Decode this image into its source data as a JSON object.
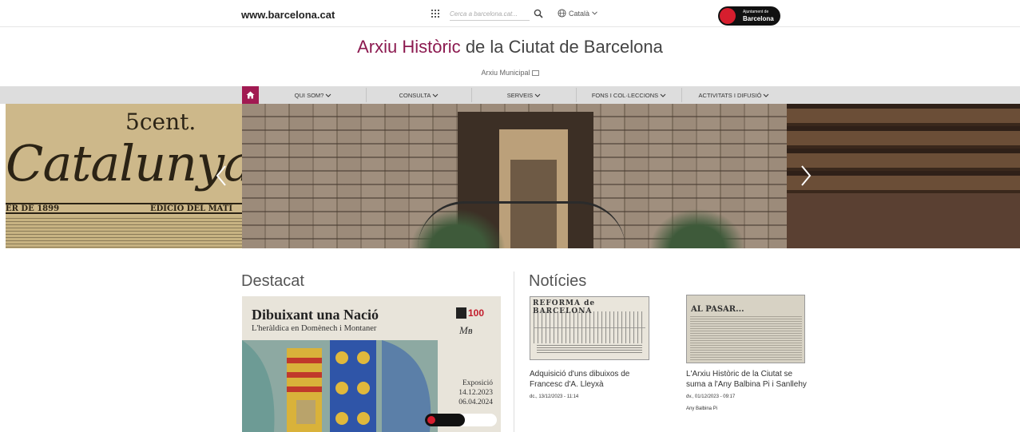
{
  "header": {
    "site_link": "www.barcelona.cat",
    "search_placeholder": "Cerca a barcelona.cat...",
    "language": "Català",
    "logo_line1": "Ajuntament de",
    "logo_line2": "Barcelona"
  },
  "page_title": {
    "accent": "Arxiu Històric",
    "rest": "de la Ciutat de Barcelona",
    "subtitle": "Arxiu Municipal"
  },
  "nav": {
    "items": [
      {
        "label": "Qui som?"
      },
      {
        "label": "Consulta"
      },
      {
        "label": "Serveis"
      },
      {
        "label": "Fons i col·leccions"
      },
      {
        "label": "Activitats i difusió"
      }
    ]
  },
  "carousel": {
    "left_slide": {
      "price": "5cent.",
      "masthead": "Catalunya",
      "date_text": "ER DE 1899",
      "edition_text": "EDICIÓ DEL MATÍ"
    }
  },
  "destacat": {
    "title": "Destacat",
    "poster": {
      "title": "Dibuixant una Nació",
      "subtitle": "L'heràldica en Domènech i Montaner",
      "badge": "100",
      "type": "Exposició",
      "date_start": "14.12.2023",
      "date_end": "06.04.2024"
    }
  },
  "noticies": {
    "title": "Notícies",
    "items": [
      {
        "image_heading": "REFORMA de BARCELONA",
        "title": "Adquisició d'uns dibuixos de Francesc d'A. Lleyxà",
        "date": "dc., 13/12/2023 - 11:14",
        "tag": ""
      },
      {
        "image_heading": "AL PASAR...",
        "title": "L'Arxiu Històric de la Ciutat se suma a l'Any Balbina Pi i Sanllehy",
        "date": "dv., 01/12/2023 - 09:17",
        "tag": "Any Balbina Pi"
      }
    ]
  },
  "colors": {
    "accent": "#8c1a50",
    "nav_bg": "#dddddd",
    "home_button": "#a11a52"
  }
}
